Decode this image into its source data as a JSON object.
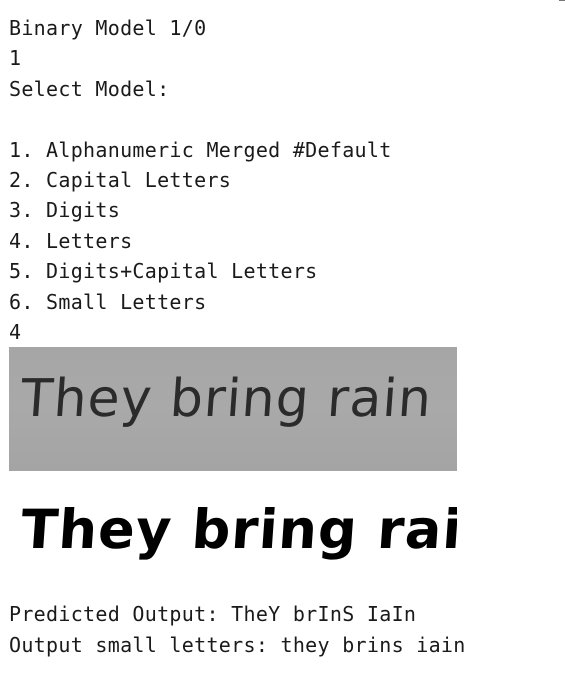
{
  "console": {
    "lines": [
      "Binary Model 1/0",
      "1",
      "Select Model:",
      "",
      "1. Alphanumeric Merged #Default",
      "2. Capital Letters",
      "3. Digits",
      "4. Letters",
      "5. Digits+Capital Letters",
      "6. Small Letters",
      "4"
    ]
  },
  "images": {
    "grayscale_text": "They bring rain",
    "binary_text": "They bring rain"
  },
  "output": {
    "predicted": "Predicted Output: TheY brInS IaIn",
    "small_letters": "Output small letters: they brins iain"
  }
}
